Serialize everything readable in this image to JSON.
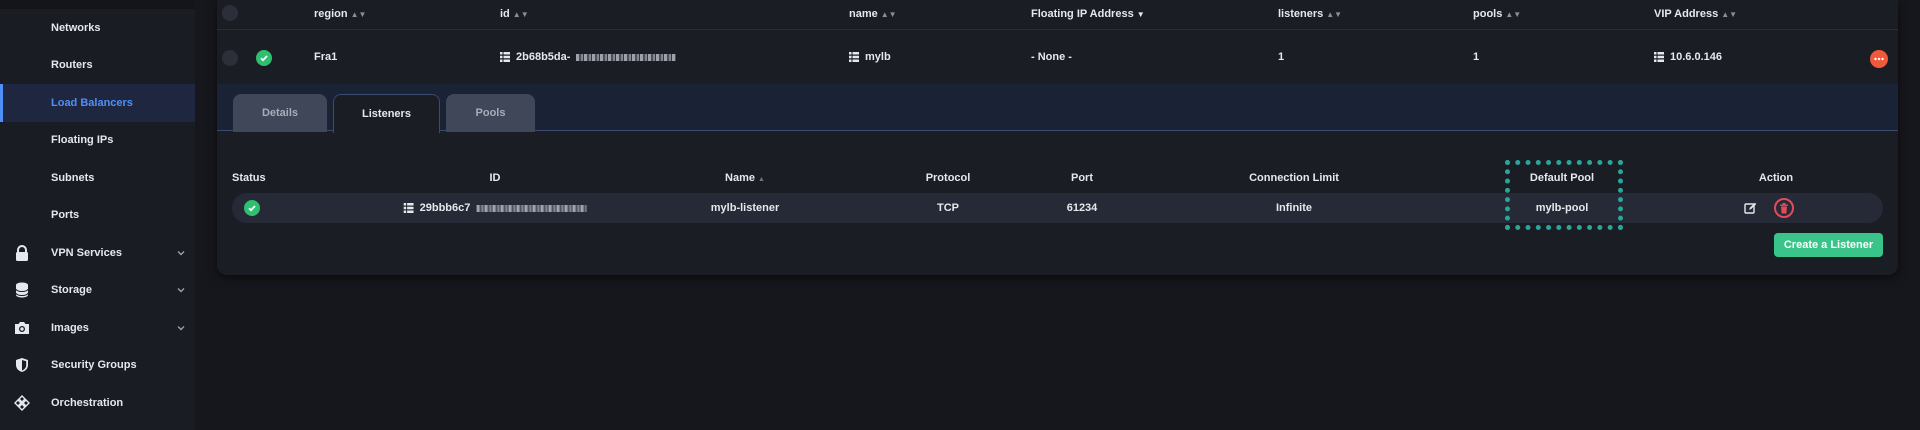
{
  "sidebar": {
    "items": [
      {
        "label": "Networks"
      },
      {
        "label": "Routers"
      },
      {
        "label": "Load Balancers",
        "active": true
      },
      {
        "label": "Floating IPs"
      },
      {
        "label": "Subnets"
      },
      {
        "label": "Ports"
      },
      {
        "label": "VPN Services",
        "icon": "lock-icon",
        "expandable": true
      },
      {
        "label": "Storage",
        "icon": "database-icon",
        "expandable": true
      },
      {
        "label": "Images",
        "icon": "camera-icon",
        "expandable": true
      },
      {
        "label": "Security Groups",
        "icon": "shield-icon"
      },
      {
        "label": "Orchestration",
        "icon": "orchestration-icon"
      }
    ]
  },
  "lb_table": {
    "headers": {
      "region": "region",
      "id": "id",
      "name": "name",
      "floating_ip": "Floating IP Address",
      "listeners": "listeners",
      "pools": "pools",
      "vip": "VIP Address"
    },
    "row": {
      "region": "Fra1",
      "id": "2b68b5da-",
      "name": "mylb",
      "floating_ip": "- None -",
      "listeners": "1",
      "pools": "1",
      "vip": "10.6.0.146"
    }
  },
  "tabs": {
    "details": "Details",
    "listeners": "Listeners",
    "pools": "Pools",
    "active": "Listeners"
  },
  "listeners_table": {
    "headers": {
      "status": "Status",
      "id": "ID",
      "name": "Name",
      "protocol": "Protocol",
      "port": "Port",
      "connection_limit": "Connection Limit",
      "default_pool": "Default Pool",
      "action": "Action"
    },
    "row": {
      "id": "29bbb6c7",
      "name": "mylb-listener",
      "protocol": "TCP",
      "port": "61234",
      "connection_limit": "Infinite",
      "default_pool": "mylb-pool"
    },
    "create_button": "Create a Listener"
  },
  "colors": {
    "accent": "#4f8ff7",
    "success": "#2fbf71",
    "danger": "#e34b5a",
    "primary_button": "#39c58a",
    "highlight": "#2aa59a"
  }
}
